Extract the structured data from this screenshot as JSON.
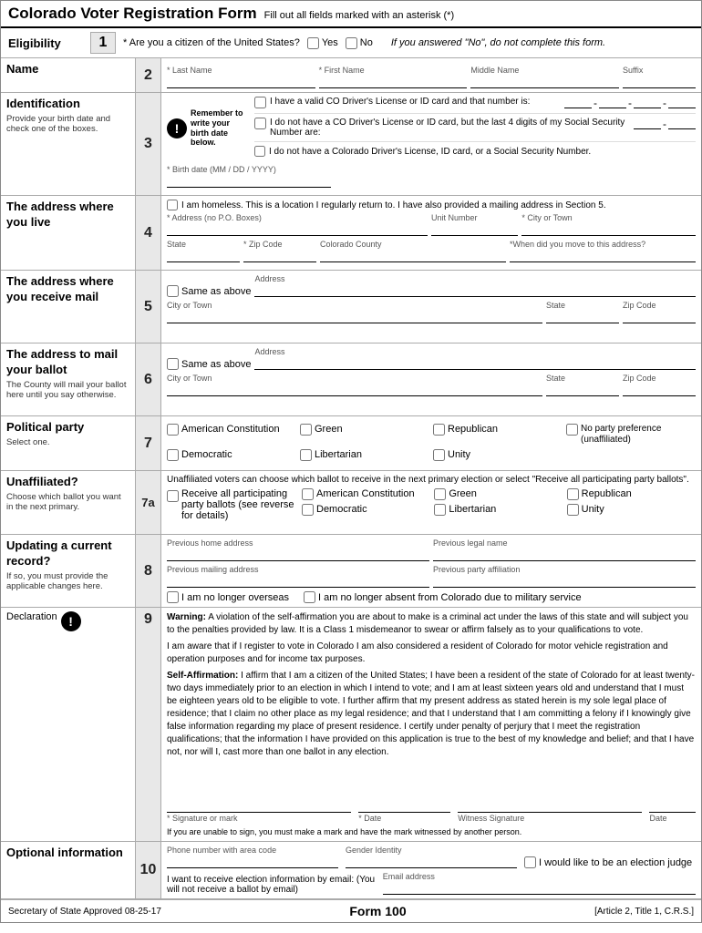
{
  "header": {
    "title": "Colorado Voter Registration Form",
    "subtitle": "Fill out all fields marked with an asterisk (*)"
  },
  "sections": {
    "eligibility": {
      "label": "Eligibility",
      "number": "1",
      "question": "* Are you a citizen of the United States?",
      "yes": "Yes",
      "no": "No",
      "note": "If you answered \"No\", do not complete this form."
    },
    "name": {
      "label": "Name",
      "number": "2",
      "last_name": "* Last Name",
      "first_name": "* First Name",
      "middle_name": "Middle Name",
      "suffix": "Suffix"
    },
    "identification": {
      "label": "Identification",
      "sub": "Provide your birth date and check one of the boxes.",
      "number": "3",
      "reminder": "Remember to write your birth date below.",
      "option1": "I have a valid CO Driver's License or ID card and that number is:",
      "option2": "I do not have a CO Driver's License or ID card, but the last 4 digits of my Social Security Number are:",
      "option3": "I do not have a Colorado Driver's License, ID card, or a Social Security Number.",
      "birth_date_label": "* Birth date (MM / DD / YYYY)"
    },
    "residence_address": {
      "label": "The address where you live",
      "number": "4",
      "homeless_note": "I am homeless. This is a location I regularly return to. I have also provided a mailing address in Section 5.",
      "address_label": "* Address (no P.O. Boxes)",
      "unit_label": "Unit Number",
      "city_label": "* City or Town",
      "state_label": "State",
      "zip_label": "* Zip Code",
      "county_label": "Colorado County",
      "move_date_label": "*When did you move to this address?"
    },
    "mailing_address": {
      "label": "The address where you receive mail",
      "number": "5",
      "same_above": "Same as above",
      "address_label": "Address",
      "city_label": "City or Town",
      "state_label": "State",
      "zip_label": "Zip Code"
    },
    "ballot_address": {
      "label": "The address to mail your ballot",
      "sublabel": "The County will mail your ballot here until you say otherwise.",
      "number": "6",
      "same_above": "Same as above",
      "address_label": "Address",
      "city_label": "City or Town",
      "state_label": "State",
      "zip_label": "Zip Code"
    },
    "political_party": {
      "label": "Political party",
      "sublabel": "Select one.",
      "number": "7",
      "parties": [
        "American Constitution",
        "Green",
        "Republican",
        "No party preference (unaffiliated)",
        "Democratic",
        "Libertarian",
        "Unity"
      ]
    },
    "unaffiliated": {
      "label": "Unaffiliated?",
      "sublabel": "Choose which ballot you want in the next primary.",
      "number": "7a",
      "note": "Unaffiliated voters can choose which ballot to receive in the next primary election or select \"Receive all participating party ballots\".",
      "receive_all": "Receive all participating party ballots (see reverse for details)",
      "parties": [
        "American Constitution",
        "Green",
        "Republican",
        "Democratic",
        "Libertarian",
        "Unity"
      ]
    },
    "updating": {
      "label": "Updating a current record?",
      "sublabel": "If so, you must provide the applicable changes here.",
      "number": "8",
      "prev_home": "Previous home address",
      "prev_legal": "Previous legal name",
      "prev_mailing": "Previous mailing address",
      "prev_party": "Previous party affiliation",
      "no_longer_overseas": "I am no longer overseas",
      "no_longer_absent": "I am no longer absent from Colorado due to military service"
    },
    "declaration": {
      "label": "Declaration",
      "number": "9",
      "warning_bold": "Warning:",
      "warning_text": " A violation of the self-affirmation you are about to make is a criminal act under the laws of this state and will subject you to the penalties provided by law. It is a Class 1 misdemeanor to swear or affirm falsely as to your qualifications to vote.",
      "aware_text": "I am aware that if I register to vote in Colorado I am also considered a resident of Colorado for motor vehicle registration and operation purposes and for income tax purposes.",
      "self_affirm_bold": "Self-Affirmation:",
      "self_affirm_text": " I affirm that I am a citizen of the United States; I have been a resident of the state of Colorado for at least twenty-two days immediately prior to an election in which I intend to vote; and I am at least sixteen years old and understand that I must be eighteen years old to be eligible to vote. I further affirm that my present address as stated herein is my sole legal place of residence; that I claim no other place as my legal residence; and that I understand that I am committing a felony if I knowingly give false information regarding my place of present residence. I certify under penalty of perjury that I meet the registration qualifications; that the information I have provided on this application is true to the best of my knowledge and belief; and that I have not, nor will I, cast more than one ballot in any election.",
      "signature_label": "* Signature or mark",
      "date_label": "* Date",
      "witness_sig_label": "Witness Signature",
      "witness_date_label": "Date",
      "sig_note": "If you are unable to sign, you must make a mark and have the mark witnessed by another person."
    },
    "optional": {
      "label": "Optional information",
      "number": "10",
      "phone_label": "Phone number with area code",
      "gender_label": "Gender Identity",
      "election_judge": "I would like to be an election judge",
      "email_note": "I want to receive election information by email: (You will not receive a ballot by email)",
      "email_label": "Email address"
    }
  },
  "footer": {
    "secretary": "Secretary of State Approved 08-25-17",
    "form_number": "Form 100",
    "article": "[Article 2, Title 1, C.R.S.]"
  }
}
